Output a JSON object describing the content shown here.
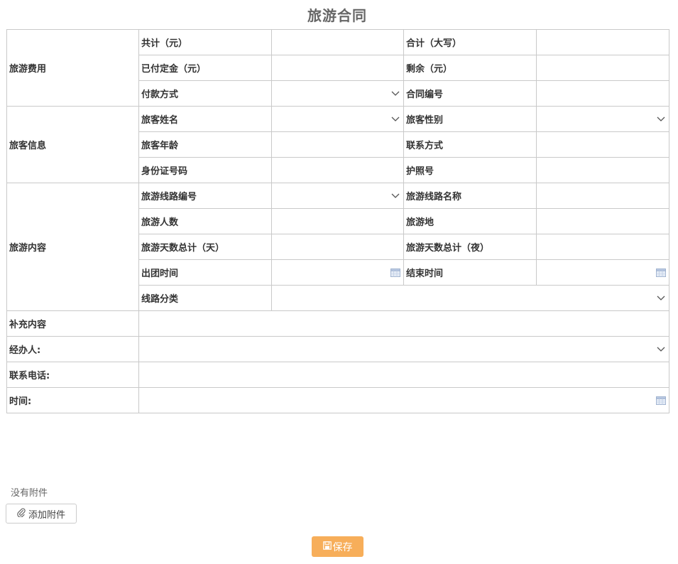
{
  "page": {
    "title": "旅游合同"
  },
  "sections": {
    "fee": "旅游费用",
    "customer": "旅客信息",
    "content": "旅游内容",
    "supplement": "补充内容"
  },
  "labels": {
    "total_yuan": "共计（元）",
    "total_capital": "合计（大写）",
    "deposit_paid": "已付定金（元）",
    "remaining": "剩余（元）",
    "payment_method": "付款方式",
    "contract_no": "合同编号",
    "customer_name": "旅客姓名",
    "customer_gender": "旅客性别",
    "customer_age": "旅客年龄",
    "contact": "联系方式",
    "id_number": "身份证号码",
    "passport": "护照号",
    "route_code": "旅游线路编号",
    "route_name": "旅游线路名称",
    "people_count": "旅游人数",
    "destination": "旅游地",
    "days_total": "旅游天数总计（天）",
    "nights_total": "旅游天数总计（夜）",
    "depart_time": "出团时间",
    "end_time": "结束时间",
    "route_category": "线路分类",
    "handler": "经办人:",
    "phone": "联系电话:",
    "time": "时间:"
  },
  "attachments": {
    "empty_text": "没有附件",
    "add_label": "添加附件"
  },
  "actions": {
    "save_label": "保存"
  },
  "colors": {
    "save_button": "#f7ae5a",
    "border": "#c9c9c9",
    "title": "#666666"
  },
  "icons": {
    "dropdown": "chevron-down-icon",
    "calendar": "calendar-icon",
    "attach": "paperclip-icon",
    "save": "save-icon"
  }
}
